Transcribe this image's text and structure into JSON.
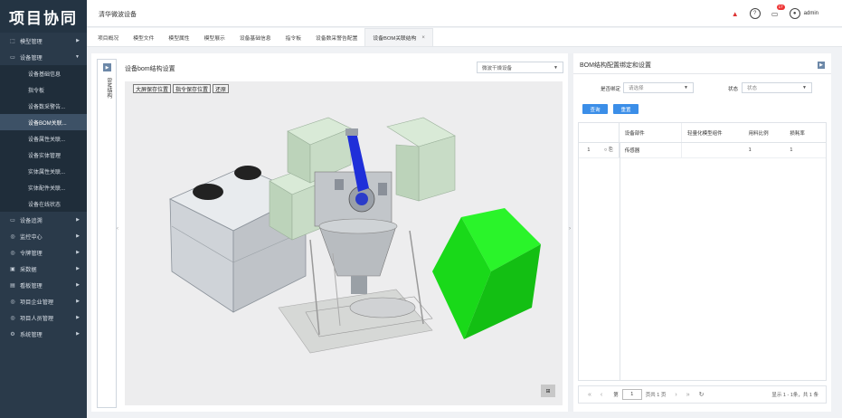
{
  "app": {
    "logo": "项目协同",
    "header_title": "清华微波设备",
    "user": "admin",
    "notification_count": "17"
  },
  "sidebar": {
    "items": [
      {
        "label": "模型管理",
        "icon": "cube-icon",
        "expanded": false
      },
      {
        "label": "设备管理",
        "icon": "device-icon",
        "expanded": true
      },
      {
        "label": "设备追溯",
        "icon": "trace-icon",
        "expanded": false
      },
      {
        "label": "监控中心",
        "icon": "monitor-icon",
        "expanded": false
      },
      {
        "label": "令牌管理",
        "icon": "token-icon",
        "expanded": false
      },
      {
        "label": "采数据",
        "icon": "data-icon",
        "expanded": false
      },
      {
        "label": "看板管理",
        "icon": "board-icon",
        "expanded": false
      },
      {
        "label": "项目企业管理",
        "icon": "company-icon",
        "expanded": false
      },
      {
        "label": "项目人员管理",
        "icon": "people-icon",
        "expanded": false
      },
      {
        "label": "系统管理",
        "icon": "system-icon",
        "expanded": false
      }
    ],
    "submenu": [
      "设备基础信息",
      "指令板",
      "设备数采警告...",
      "设备BOM关联...",
      "设备属性关联...",
      "设备实体管理",
      "实体属性关联...",
      "实体配件关联...",
      "设备在线状态"
    ],
    "active_submenu": "设备BOM关联..."
  },
  "tabs": [
    {
      "label": "项目概况",
      "active": false
    },
    {
      "label": "模型文件",
      "active": false
    },
    {
      "label": "模型属性",
      "active": false
    },
    {
      "label": "模型展示",
      "active": false
    },
    {
      "label": "设备基础信息",
      "active": false
    },
    {
      "label": "指令板",
      "active": false
    },
    {
      "label": "设备数采警告配置",
      "active": false
    },
    {
      "label": "设备BOM关联结构",
      "active": true,
      "closable": true
    }
  ],
  "left_panel": {
    "vertical_label": "BIM结构",
    "title": "设备bom结构设置",
    "device_select": "微波干燥设备",
    "view_buttons": [
      "大屏保存位置",
      "指令保存位置",
      "还原"
    ],
    "corner_button": "⊞"
  },
  "right_panel": {
    "title": "BOM结构配置绑定和设置",
    "filters": {
      "bind_label": "是否绑定",
      "bind_placeholder": "请选择",
      "status_label": "状态",
      "status_placeholder": "状态"
    },
    "query_button": "查询",
    "reset_button": "重置",
    "table": {
      "columns": [
        "",
        "",
        "设备部件",
        "轻量化模型组件",
        "用料比例",
        "损耗率"
      ],
      "rows": [
        {
          "index": "1",
          "part": "传感器",
          "component": "",
          "ratio": "1",
          "loss": "1"
        }
      ]
    },
    "pager": {
      "prefix": "第",
      "page": "1",
      "suffix": "页共 1 页",
      "info": "显示 1 - 1条，共 1 条"
    }
  },
  "colors": {
    "sidebar_bg": "#2a3a4a",
    "accent_blue": "#3b8ee8",
    "model_green": "#22e622"
  }
}
